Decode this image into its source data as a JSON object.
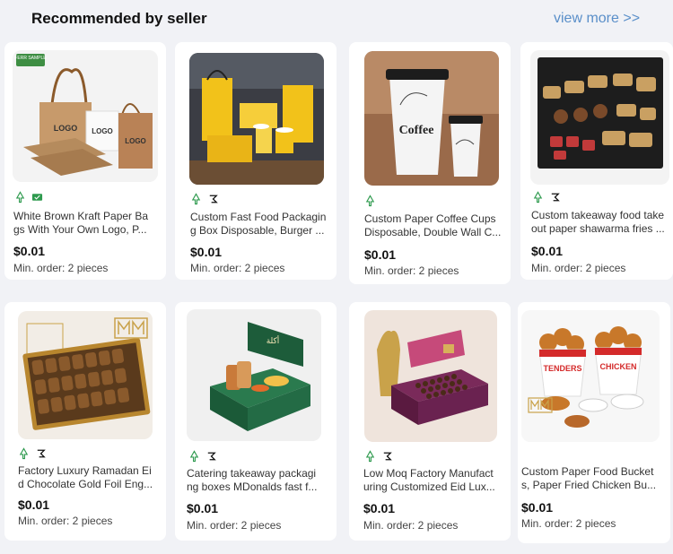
{
  "section": {
    "title": "Recommended by seller",
    "view_more": "view more  >>"
  },
  "products": [
    {
      "title_line1": "White Brown Kraft Paper Ba",
      "title_line2": "gs With Your Own Logo, P...",
      "price": "$0.01",
      "min_order": "Min. order: 2 pieces",
      "image_text_1": "LOGO",
      "image_text_2": "LOGO",
      "image_text_3": "LOGO",
      "image_tag": "FERR SAMPLE"
    },
    {
      "title_line1": "Custom Fast Food Packagin",
      "title_line2": "g Box Disposable, Burger ...",
      "price": "$0.01",
      "min_order": "Min. order: 2 pieces"
    },
    {
      "title_line1": "Custom Paper Coffee Cups",
      "title_line2": "Disposable, Double Wall C...",
      "price": "$0.01",
      "min_order": "Min. order: 2 pieces",
      "image_text_1": "Coffee"
    },
    {
      "title_line1": "Custom takeaway food take",
      "title_line2": "out paper shawarma fries ...",
      "price": "$0.01",
      "min_order": "Min. order: 2 pieces"
    },
    {
      "title_line1": "Factory Luxury Ramadan Ei",
      "title_line2": "d Chocolate Gold Foil Eng...",
      "price": "$0.01",
      "min_order": "Min. order: 2 pieces"
    },
    {
      "title_line1": "Catering takeaway packagi",
      "title_line2": "ng boxes MDonalds fast f...",
      "price": "$0.01",
      "min_order": "Min. order: 2 pieces"
    },
    {
      "title_line1": "Low Moq Factory Manufact",
      "title_line2": "uring Customized Eid Lux...",
      "price": "$0.01",
      "min_order": "Min. order: 2 pieces"
    },
    {
      "title_line1": "Custom Paper Food Bucket",
      "title_line2": "s, Paper Fried Chicken Bu...",
      "price": "$0.01",
      "min_order": "Min. order: 2 pieces",
      "image_text_1": "TENDERS",
      "image_text_2": "CHICKEN"
    }
  ],
  "colors": {
    "accent_link": "#5a8fc9",
    "badge_green": "#2e9a4e"
  }
}
